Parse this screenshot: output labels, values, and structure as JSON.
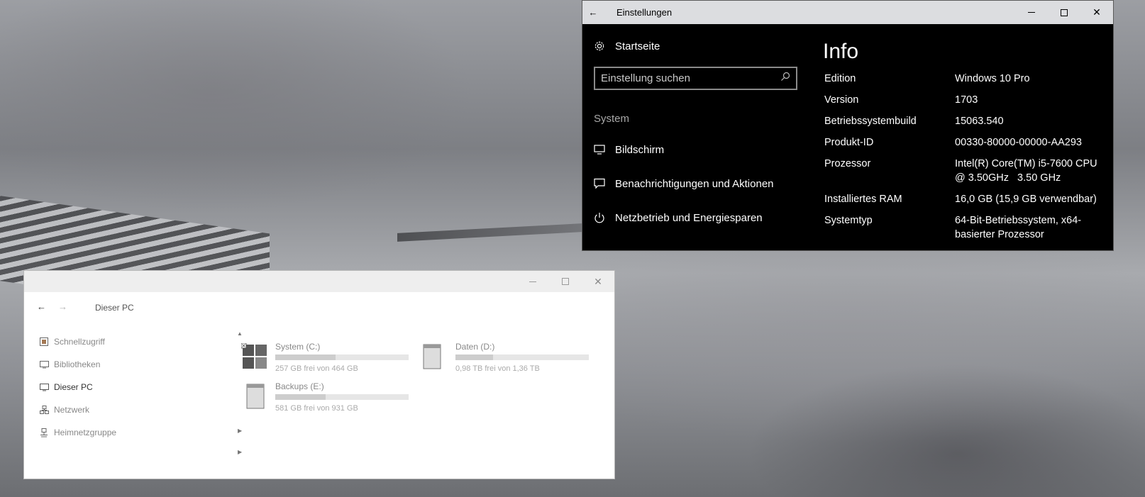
{
  "settings": {
    "window_title": "Einstellungen",
    "home_label": "Startseite",
    "search_placeholder": "Einstellung suchen",
    "section_label": "System",
    "nav_items": [
      {
        "label": "Bildschirm",
        "icon": "monitor-icon"
      },
      {
        "label": "Benachrichtigungen und Aktionen",
        "icon": "notification-icon"
      },
      {
        "label": "Netzbetrieb und Energiesparen",
        "icon": "power-icon"
      }
    ],
    "page_heading": "Info",
    "info": [
      {
        "key": "Edition",
        "value": "Windows 10 Pro"
      },
      {
        "key": "Version",
        "value": "1703"
      },
      {
        "key": "Betriebssystembuild",
        "value": "15063.540"
      },
      {
        "key": "Produkt-ID",
        "value": "00330-80000-00000-AA293"
      },
      {
        "key": "Prozessor",
        "value": "Intel(R) Core(TM) i5-7600 CPU @ 3.50GHz   3.50 GHz"
      },
      {
        "key": "Installiertes RAM",
        "value": "16,0 GB (15,9 GB verwendbar)"
      },
      {
        "key": "Systemtyp",
        "value": "64-Bit-Betriebssystem, x64-basierter Prozessor"
      }
    ]
  },
  "explorer": {
    "breadcrumb": "Dieser PC",
    "sidebar": [
      {
        "label": "Schnellzugriff",
        "icon": "quick-access-icon",
        "active": false
      },
      {
        "label": "Bibliotheken",
        "icon": "libraries-icon",
        "active": false
      },
      {
        "label": "Dieser PC",
        "icon": "this-pc-icon",
        "active": true
      },
      {
        "label": "Netzwerk",
        "icon": "network-icon",
        "active": false
      },
      {
        "label": "Heimnetzgruppe",
        "icon": "homegroup-icon",
        "active": false
      }
    ],
    "drives": [
      {
        "name": "System (C:)",
        "free_text": "257 GB frei von 464 GB",
        "used_fraction": 0.45,
        "icon": "windows-drive-icon"
      },
      {
        "name": "Daten (D:)",
        "free_text": "0,98 TB frei von 1,36 TB",
        "used_fraction": 0.28,
        "icon": "hard-drive-icon"
      },
      {
        "name": "Backups (E:)",
        "free_text": "581 GB frei von 931 GB",
        "used_fraction": 0.38,
        "icon": "hard-drive-icon"
      }
    ]
  },
  "colors": {
    "settings_bg": "#000000",
    "settings_titlebar": "#dcdde0",
    "explorer_bg": "#ffffff",
    "drive_bar_fill": "#cdcdcd"
  }
}
